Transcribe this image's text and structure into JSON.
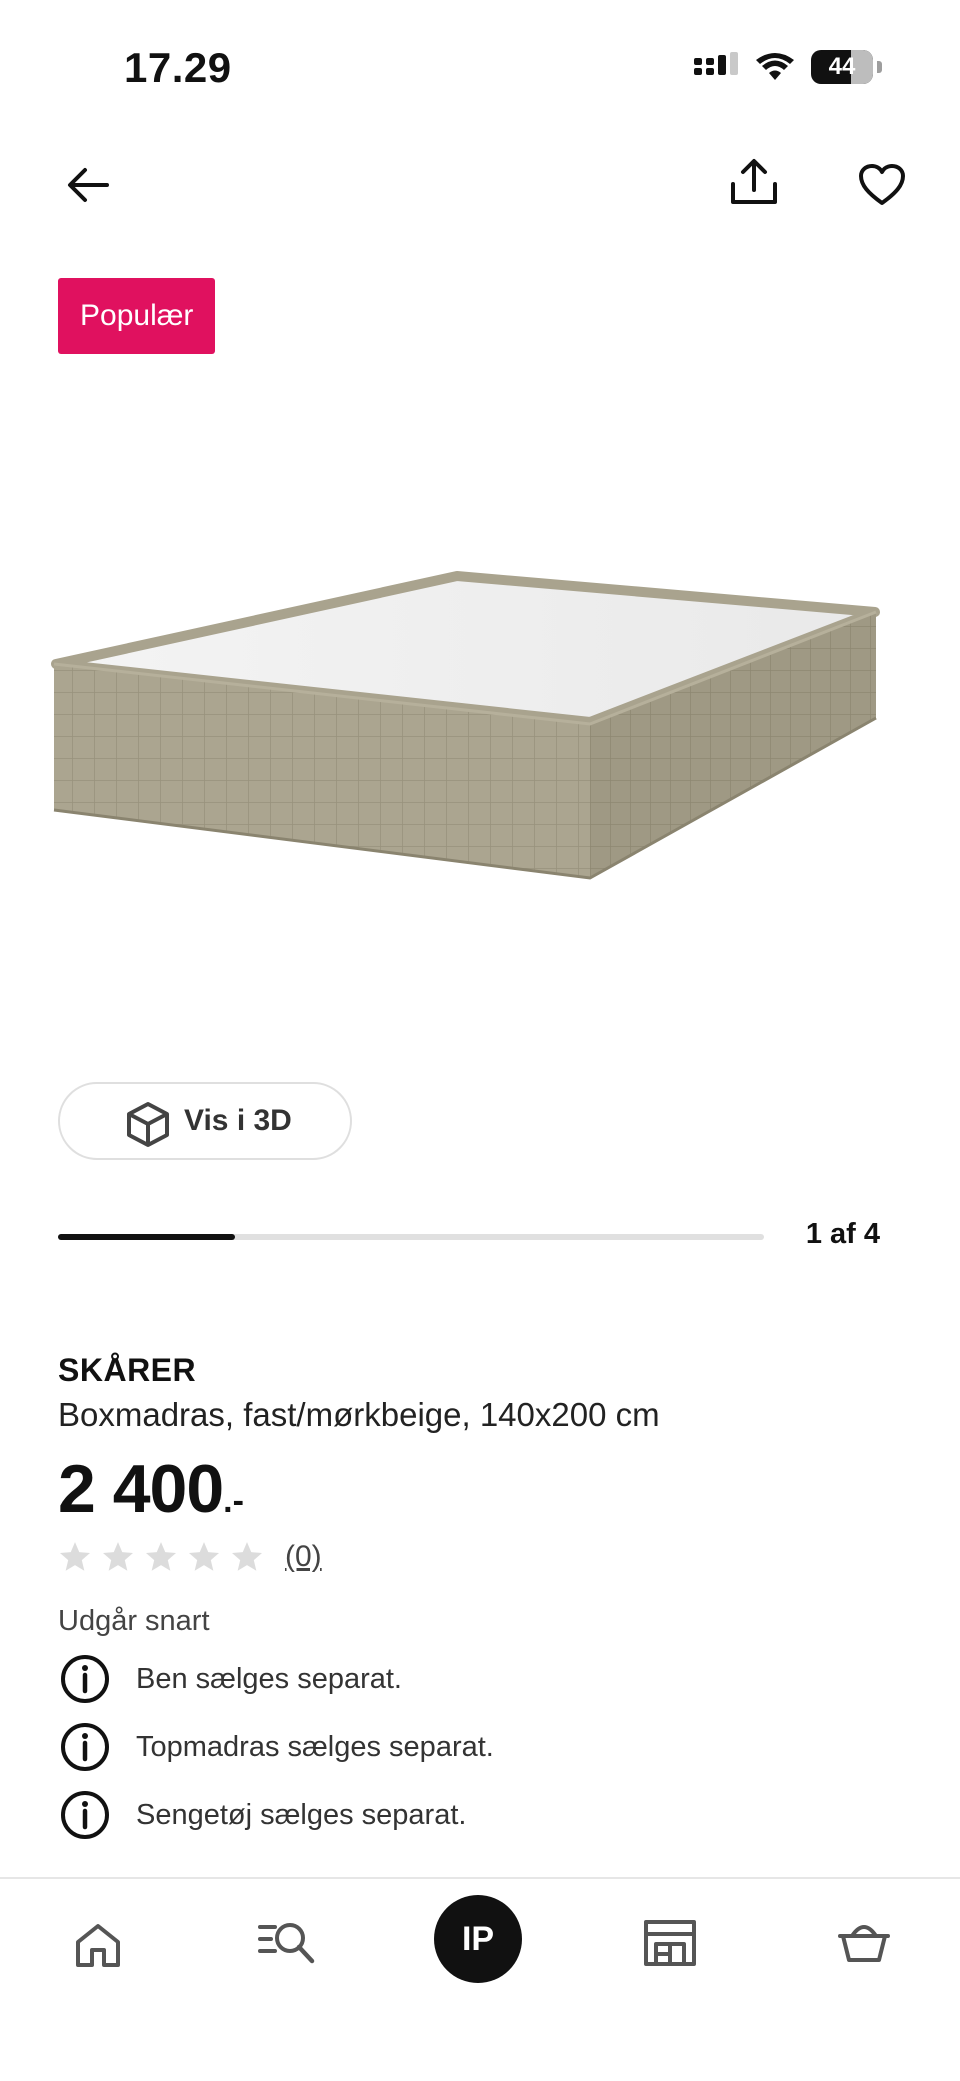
{
  "status_bar": {
    "time": "17.29",
    "battery": "44"
  },
  "header": {
    "back_icon": "arrow-left-icon",
    "share_icon": "share-icon",
    "favorite_icon": "heart-icon"
  },
  "badge": {
    "label": "Populær",
    "color": "#e0115f"
  },
  "gallery": {
    "view_3d_label": "Vis i 3D",
    "counter": "1 af 4",
    "current": 1,
    "total": 4
  },
  "product": {
    "name": "SKÅRER",
    "description": "Boxmadras, fast/mørkbeige, 140x200 cm",
    "price": "2 400",
    "price_suffix": ".-",
    "rating_stars": 0,
    "rating_max": 5,
    "rating_count": "(0)",
    "status": "Udgår snart"
  },
  "info_notes": [
    "Ben sælges separat.",
    "Topmadras sælges separat.",
    "Sengetøj sælges separat."
  ],
  "bottom_nav": {
    "items": [
      "home-icon",
      "search-icon",
      "profile-avatar",
      "store-icon",
      "basket-icon"
    ],
    "avatar_initials": "IP"
  }
}
